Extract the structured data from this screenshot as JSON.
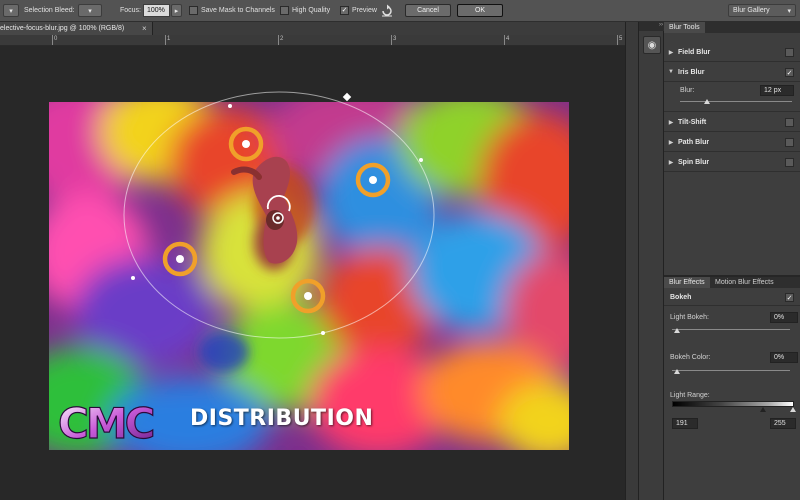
{
  "options_bar": {
    "selection_bleed_label": "Selection Bleed:",
    "focus_label": "Focus:",
    "focus_value": "100%",
    "save_mask_label": "Save Mask to Channels",
    "save_mask_checked": false,
    "high_quality_label": "High Quality",
    "high_quality_checked": false,
    "preview_label": "Preview",
    "preview_checked": true,
    "cancel_label": "Cancel",
    "ok_label": "OK",
    "workspace_label": "Blur Gallery"
  },
  "document": {
    "tab_title": "elective-focus-blur.jpg @ 100% (RGB/8)",
    "ruler_numbers": [
      "0",
      "1",
      "2",
      "3",
      "4",
      "5"
    ]
  },
  "blur_tools": {
    "tab_label": "Blur Tools",
    "items": [
      {
        "label": "Field Blur",
        "expanded": false,
        "checked": false
      },
      {
        "label": "Iris Blur",
        "expanded": true,
        "checked": true
      },
      {
        "label": "Tilt-Shift",
        "expanded": false,
        "checked": false
      },
      {
        "label": "Path Blur",
        "expanded": false,
        "checked": false
      },
      {
        "label": "Spin Blur",
        "expanded": false,
        "checked": false
      }
    ],
    "blur_label": "Blur:",
    "blur_value": "12 px"
  },
  "blur_effects": {
    "tabs": [
      "Blur Effects",
      "Motion Blur Effects"
    ],
    "bokeh_label": "Bokeh",
    "bokeh_checked": true,
    "light_bokeh_label": "Light Bokeh:",
    "light_bokeh_value": "0%",
    "bokeh_color_label": "Bokeh Color:",
    "bokeh_color_value": "0%",
    "light_range_label": "Light Range:",
    "light_range_low": "191",
    "light_range_high": "255"
  },
  "logo": {
    "mark_text": "CMC",
    "wordmark": "DISTRIBUTION"
  },
  "colors": {
    "focus_pin": "#f0a02a",
    "panel_bg": "#3e3e3e",
    "options_bar_bg": "#535353"
  }
}
